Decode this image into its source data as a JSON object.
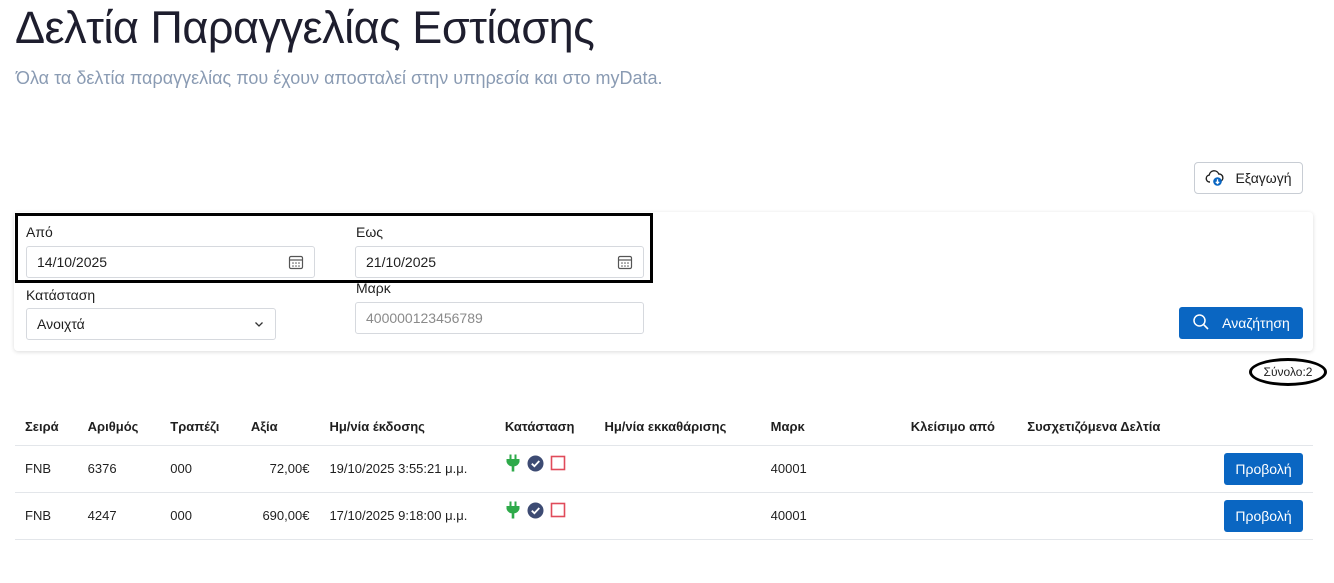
{
  "header": {
    "title": "Δελτία Παραγγελίας Εστίασης",
    "subtitle": "Όλα τα δελτία παραγγελίας που έχουν αποσταλεί στην υπηρεσία και στο myData."
  },
  "toolbar": {
    "export_label": "Εξαγωγή",
    "export_icon": "cloud-download-icon"
  },
  "filters": {
    "from_label": "Από",
    "from_value": "14/10/2025",
    "to_label": "Εως",
    "to_value": "21/10/2025",
    "status_label": "Κατάσταση",
    "status_value": "Ανοιχτά",
    "mark_label": "Μαρκ",
    "mark_placeholder": "400000123456789",
    "search_label": "Αναζήτηση"
  },
  "summary": {
    "total_text": "Σύνολο:2"
  },
  "table": {
    "columns": [
      "Σειρά",
      "Αριθμός",
      "Τραπέζι",
      "Αξία",
      "Ημ/νία έκδοσης",
      "Κατάσταση",
      "Ημ/νία εκκαθάρισης",
      "Μαρκ",
      "Κλείσιμο από",
      "Συσχετιζόμενα Δελτία"
    ],
    "rows": [
      {
        "series": "FNB",
        "number": "6376",
        "table": "000",
        "value": "72,00€",
        "issue_date": "19/10/2025 3:55:21 μ.μ.",
        "settlement_date": "",
        "mark": "40001",
        "closed_by": "",
        "related": "",
        "action_label": "Προβολή"
      },
      {
        "series": "FNB",
        "number": "4247",
        "table": "000",
        "value": "690,00€",
        "issue_date": "17/10/2025 9:18:00 μ.μ.",
        "settlement_date": "",
        "mark": "40001",
        "closed_by": "",
        "related": "",
        "action_label": "Προβολή"
      }
    ],
    "status_icons": [
      "plug-icon",
      "check-circle-icon",
      "empty-checkbox-icon"
    ]
  },
  "colors": {
    "primary": "#0a66c2",
    "subtitle": "#8a9bb3",
    "plug_green": "#2eaa4a",
    "check_navy": "#3d4b73",
    "box_red": "#e04b5a"
  }
}
